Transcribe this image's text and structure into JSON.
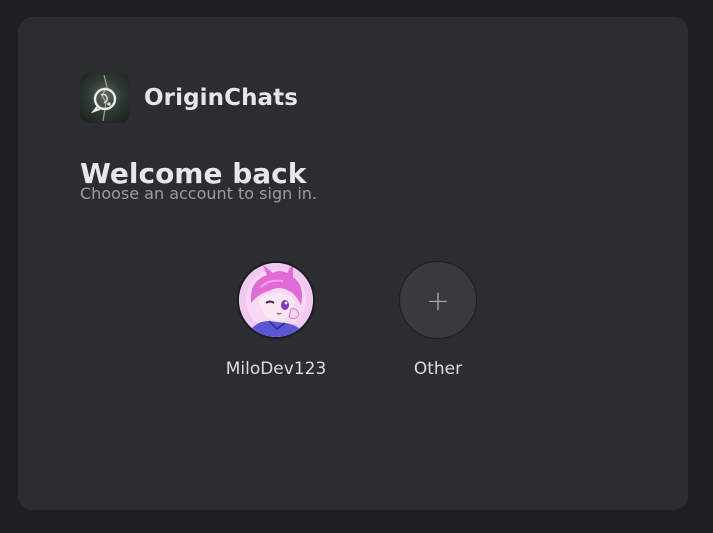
{
  "brand": {
    "name": "OriginChats",
    "logo_icon": "origin-chats-logo"
  },
  "welcome": {
    "title": "Welcome back",
    "subtitle": "Choose an account to sign in."
  },
  "accounts": [
    {
      "username": "MiloDev123",
      "avatar_icon": "user-avatar"
    },
    {
      "label": "Other",
      "icon": "plus-icon",
      "icon_glyph": "+"
    }
  ],
  "colors": {
    "page_background": "#1e1f22",
    "card_background": "#2b2d31",
    "text_primary": "#e6e7ea",
    "text_muted": "#9a9ca3",
    "add_button_background": "#383a40"
  }
}
